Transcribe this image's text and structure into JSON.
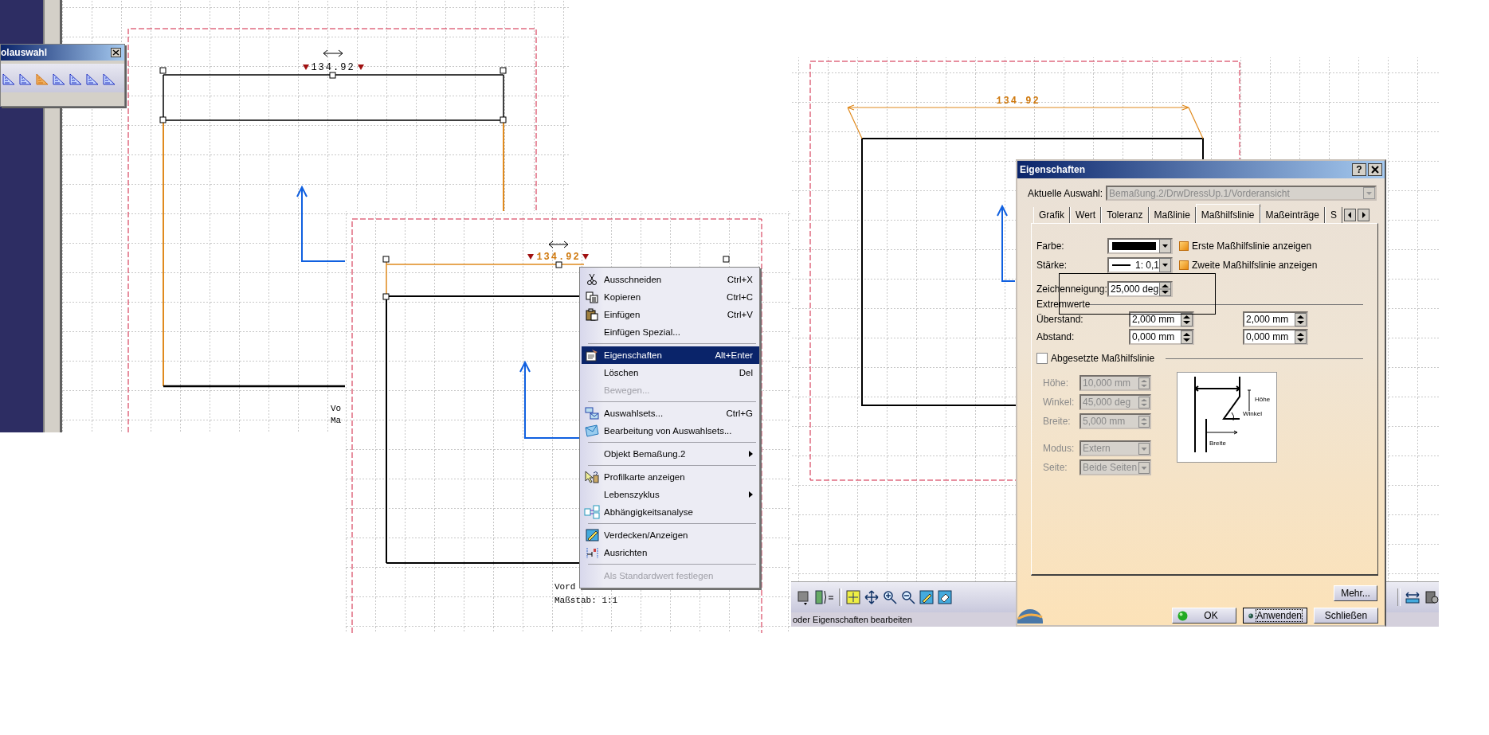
{
  "left_view": {
    "toolbar": {
      "title": "olauswahl"
    },
    "dimension": "134.92",
    "view_label": [
      "Vo",
      "Ma"
    ]
  },
  "middle_view": {
    "dimension": "134.92",
    "view_label": [
      "Vord",
      "Maßstab:  1:1"
    ]
  },
  "context_menu": {
    "groups": [
      [
        {
          "label": "Ausschneiden",
          "shortcut": "Ctrl+X",
          "disabled": false,
          "selected": false,
          "submenu": false
        },
        {
          "label": "Kopieren",
          "shortcut": "Ctrl+C",
          "disabled": false,
          "selected": false,
          "submenu": false
        },
        {
          "label": "Einfügen",
          "shortcut": "Ctrl+V",
          "disabled": false,
          "selected": false,
          "submenu": false
        },
        {
          "label": "Einfügen Spezial...",
          "disabled": false,
          "selected": false,
          "submenu": false
        }
      ],
      [
        {
          "label": "Eigenschaften",
          "shortcut": "Alt+Enter",
          "disabled": false,
          "selected": true,
          "submenu": false
        },
        {
          "label": "Löschen",
          "shortcut": "Del",
          "disabled": false,
          "selected": false,
          "submenu": false
        },
        {
          "label": "Bewegen...",
          "disabled": true,
          "selected": false,
          "submenu": false
        }
      ],
      [
        {
          "label": "Auswahlsets...",
          "shortcut": "Ctrl+G",
          "disabled": false,
          "selected": false,
          "submenu": false
        },
        {
          "label": "Bearbeitung von Auswahlsets...",
          "disabled": false,
          "selected": false,
          "submenu": false
        }
      ],
      [
        {
          "label": "Objekt Bemaßung.2",
          "disabled": false,
          "selected": false,
          "submenu": true
        }
      ],
      [
        {
          "label": "Profilkarte anzeigen",
          "disabled": false,
          "selected": false,
          "submenu": false
        },
        {
          "label": "Lebenszyklus",
          "disabled": false,
          "selected": false,
          "submenu": true
        },
        {
          "label": "Abhängigkeitsanalyse",
          "disabled": false,
          "selected": false,
          "submenu": false
        }
      ],
      [
        {
          "label": "Verdecken/Anzeigen",
          "disabled": false,
          "selected": false,
          "submenu": false
        },
        {
          "label": "Ausrichten",
          "disabled": false,
          "selected": false,
          "submenu": false
        }
      ],
      [
        {
          "label": "Als Standardwert festlegen",
          "disabled": true,
          "selected": false,
          "submenu": false
        }
      ]
    ]
  },
  "right_view": {
    "dimension": "134.92",
    "status_text": "oder Eigenschaften bearbeiten"
  },
  "dialog": {
    "title": "Eigenschaften",
    "help_button": "?",
    "selection_label": "Aktuelle Auswahl:",
    "selection_value": "Bemaßung.2/DrwDressUp.1/Vorderansicht",
    "tabs": [
      {
        "label": "Grafik",
        "selected": false
      },
      {
        "label": "Wert",
        "selected": false
      },
      {
        "label": "Toleranz",
        "selected": false
      },
      {
        "label": "Maßlinie",
        "selected": false
      },
      {
        "label": "Maßhilfslinie",
        "selected": true
      },
      {
        "label": "Maßeinträge",
        "selected": false
      },
      {
        "label": "S",
        "selected": false
      }
    ],
    "color_label": "Farbe:",
    "thickness_label": "Stärke:",
    "thickness_value": "1: 0,1",
    "checks": [
      {
        "label": "Erste Maßhilfslinie anzeigen",
        "checked": true
      },
      {
        "label": "Zweite Maßhilfslinie anzeigen",
        "checked": true
      }
    ],
    "slant_label": "Zeichenneigung:",
    "slant_value": "25,000 deg",
    "extremes_title": "Extremwerte",
    "extremes": [
      {
        "label": "Überstand:",
        "values": [
          "2,000 mm",
          "2,000 mm"
        ]
      },
      {
        "label": "Abstand:",
        "values": [
          "0,000 mm",
          "0,000 mm"
        ]
      }
    ],
    "offset": {
      "label": "Abgesetzte Maßhilfslinie",
      "checked": false
    },
    "offset_fields": [
      {
        "label": "Höhe:",
        "value": "10,000 mm",
        "kind": "spinner",
        "disabled": true
      },
      {
        "label": "Winkel:",
        "value": "45,000 deg",
        "kind": "spinner",
        "disabled": true
      },
      {
        "label": "Breite:",
        "value": "5,000 mm",
        "kind": "spinner",
        "disabled": true
      },
      {
        "label": "Modus:",
        "value": "Extern",
        "kind": "dropdown",
        "disabled": true
      },
      {
        "label": "Seite:",
        "value": "Beide Seiten",
        "kind": "dropdown",
        "disabled": true
      }
    ],
    "diagram_labels": [
      "Höhe",
      "Winkel",
      "Breite"
    ],
    "more_button": "Mehr...",
    "buttons": [
      {
        "label": "OK",
        "kind": "ok",
        "focused": false
      },
      {
        "label": "Anwenden",
        "kind": "apply",
        "focused": true
      },
      {
        "label": "Schließen",
        "kind": "close",
        "focused": false
      }
    ]
  }
}
